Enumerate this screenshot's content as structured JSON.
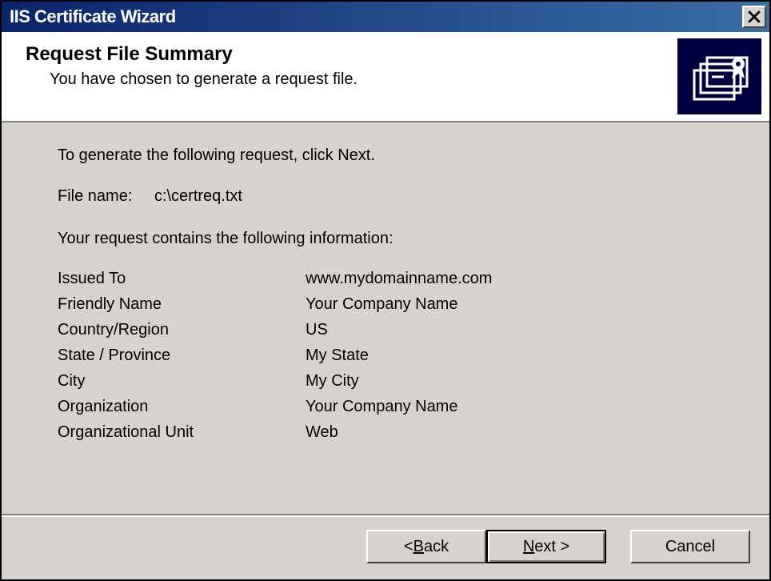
{
  "window": {
    "title": "IIS Certificate Wizard"
  },
  "header": {
    "title": "Request File Summary",
    "subtitle": "You have chosen to generate a request file."
  },
  "content": {
    "intro": "To generate the following request, click Next.",
    "file_label": "File name:",
    "file_value": "c:\\certreq.txt",
    "info_intro": "Your request contains the following information:",
    "fields": [
      {
        "k": "Issued To",
        "v": "www.mydomainname.com"
      },
      {
        "k": "Friendly Name",
        "v": "Your Company Name"
      },
      {
        "k": "Country/Region",
        "v": "US"
      },
      {
        "k": "State / Province",
        "v": "My State"
      },
      {
        "k": "City",
        "v": "My City"
      },
      {
        "k": "Organization",
        "v": "Your Company Name"
      },
      {
        "k": "Organizational Unit",
        "v": "Web"
      }
    ]
  },
  "buttons": {
    "back_prefix": "< ",
    "back_u": "B",
    "back_rest": "ack",
    "next_u": "N",
    "next_rest": "ext >",
    "cancel": "Cancel"
  }
}
